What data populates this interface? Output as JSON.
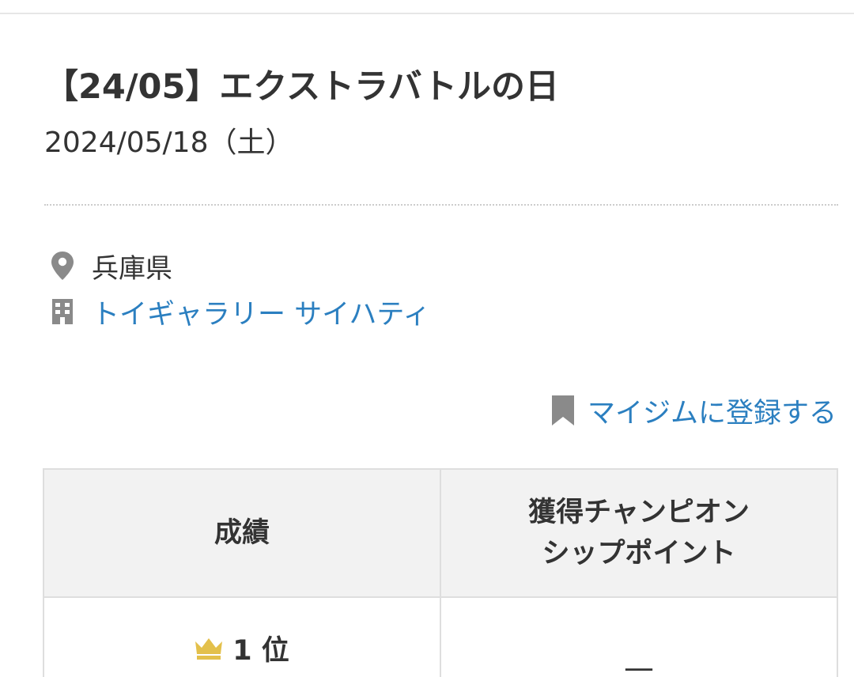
{
  "event": {
    "title": "【24/05】エクストラバトルの日",
    "date": "2024/05/18（土）"
  },
  "location": {
    "prefecture": "兵庫県",
    "shop_name": "トイギャラリー サイハティ",
    "prefecture_icon": "location-pin-icon",
    "shop_icon": "building-icon"
  },
  "actions": {
    "mygym_label": "マイジムに登録する",
    "mygym_icon": "bookmark-icon"
  },
  "results_table": {
    "headers": {
      "result": "成績",
      "points_line1": "獲得チャンピオン",
      "points_line2": "シップポイント"
    },
    "rows": [
      {
        "rank": "1 位",
        "points": "—",
        "rank_icon": "crown-icon"
      }
    ]
  },
  "colors": {
    "link": "#2b7fc0",
    "text": "#333333",
    "icon_gray": "#8a8a8a",
    "crown_gold": "#e3c04b",
    "header_bg": "#f2f2f2",
    "border": "#dedede"
  }
}
